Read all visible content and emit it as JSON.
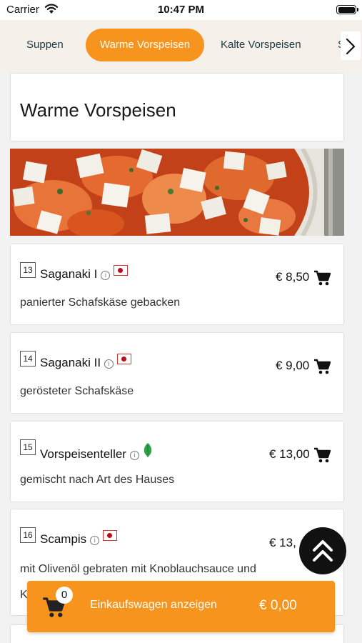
{
  "status": {
    "carrier": "Carrier",
    "time": "10:47 PM"
  },
  "tabs": {
    "items": [
      {
        "label": "Suppen"
      },
      {
        "label": "Warme Vorspeisen"
      },
      {
        "label": "Kalte Vorspeisen"
      },
      {
        "label": "S"
      }
    ],
    "active": "Warme Vorspeisen"
  },
  "section": {
    "title": "Warme Vorspeisen"
  },
  "items": [
    {
      "number": "13",
      "name": "Saganaki I",
      "description": "panierter Schafskäse gebacken",
      "price": "€ 8,50",
      "badge": "flag-icon"
    },
    {
      "number": "14",
      "name": "Saganaki II",
      "description": "gerösteter Schafskäse",
      "price": "€ 9,00",
      "badge": "flag-icon"
    },
    {
      "number": "15",
      "name": "Vorspeisenteller",
      "description": "gemischt nach Art des Hauses",
      "price": "€ 13,00",
      "badge": "leaf-icon"
    },
    {
      "number": "16",
      "name": "Scampis",
      "description": "mit Olivenöl gebraten mit Knoblauchsauce und",
      "description_line2": "K",
      "price": "€ 13,",
      "badge": "flag-icon"
    }
  ],
  "cart": {
    "count": "0",
    "label": "Einkaufswagen anzeigen",
    "total": "€ 0,00"
  },
  "colors": {
    "accent": "#f7941d",
    "tab_text": "#1e3a44",
    "fab": "#111111"
  }
}
